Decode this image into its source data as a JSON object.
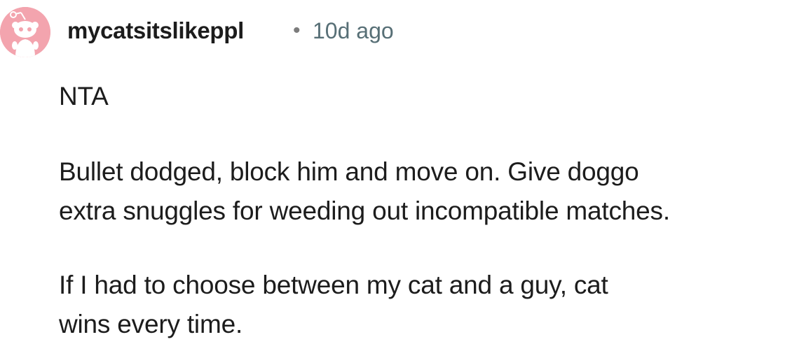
{
  "comment": {
    "author": "mycatsitslikeppl",
    "separator": "•",
    "time": "10d ago",
    "avatar_icon": "reddit-snoo-avatar-icon",
    "avatar_color": "#f3a4ae",
    "paragraphs": [
      "NTA",
      "Bullet dodged, block him and move on. Give doggo extra snuggles for weeding out incompatible matches.",
      "If I had to choose between my cat and a guy, cat wins every time."
    ]
  }
}
